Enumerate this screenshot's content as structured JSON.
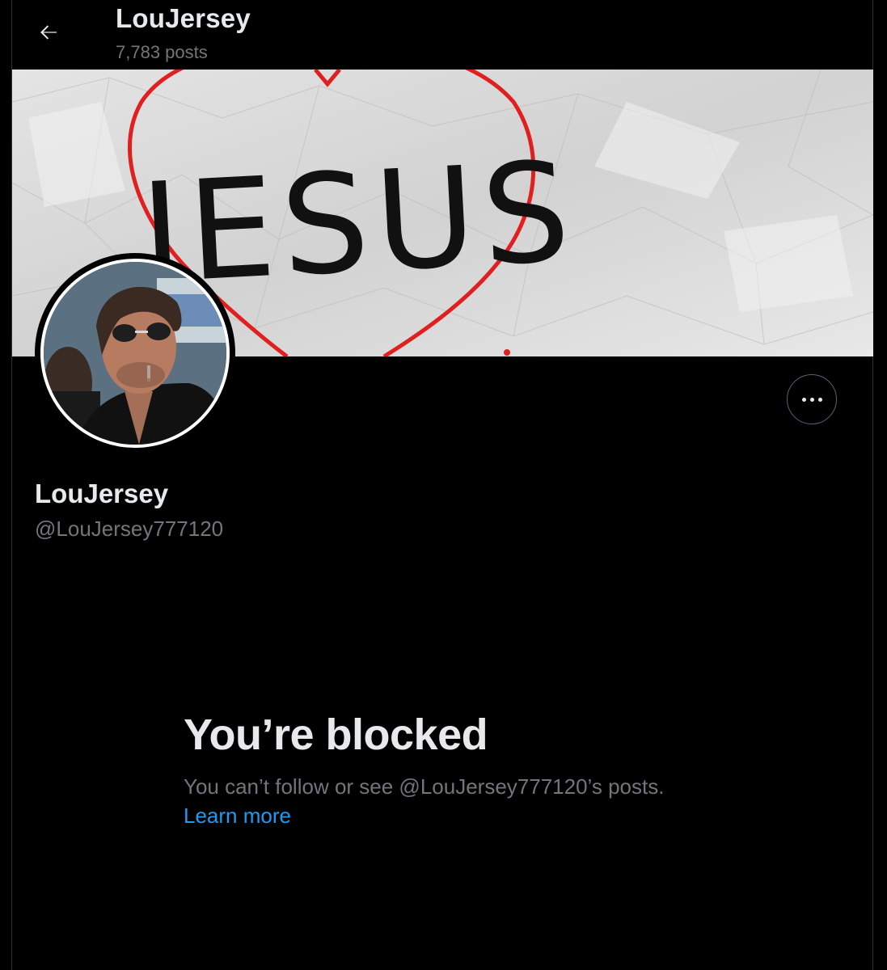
{
  "header": {
    "title": "LouJersey",
    "post_count": "7,783 posts",
    "back_icon": "arrow-left-icon"
  },
  "banner": {
    "text": "JESUS",
    "heart_color": "#e02020"
  },
  "profile": {
    "display_name": "LouJersey",
    "handle": "@LouJersey777120",
    "more_icon": "more-horizontal-icon"
  },
  "blocked": {
    "title": "You’re blocked",
    "message": "You can’t follow or see @LouJersey777120’s posts.",
    "learn_more": "Learn more"
  },
  "colors": {
    "background": "#000000",
    "text_primary": "#e7e9ea",
    "text_secondary": "#71767b",
    "link": "#1d9bf0"
  }
}
